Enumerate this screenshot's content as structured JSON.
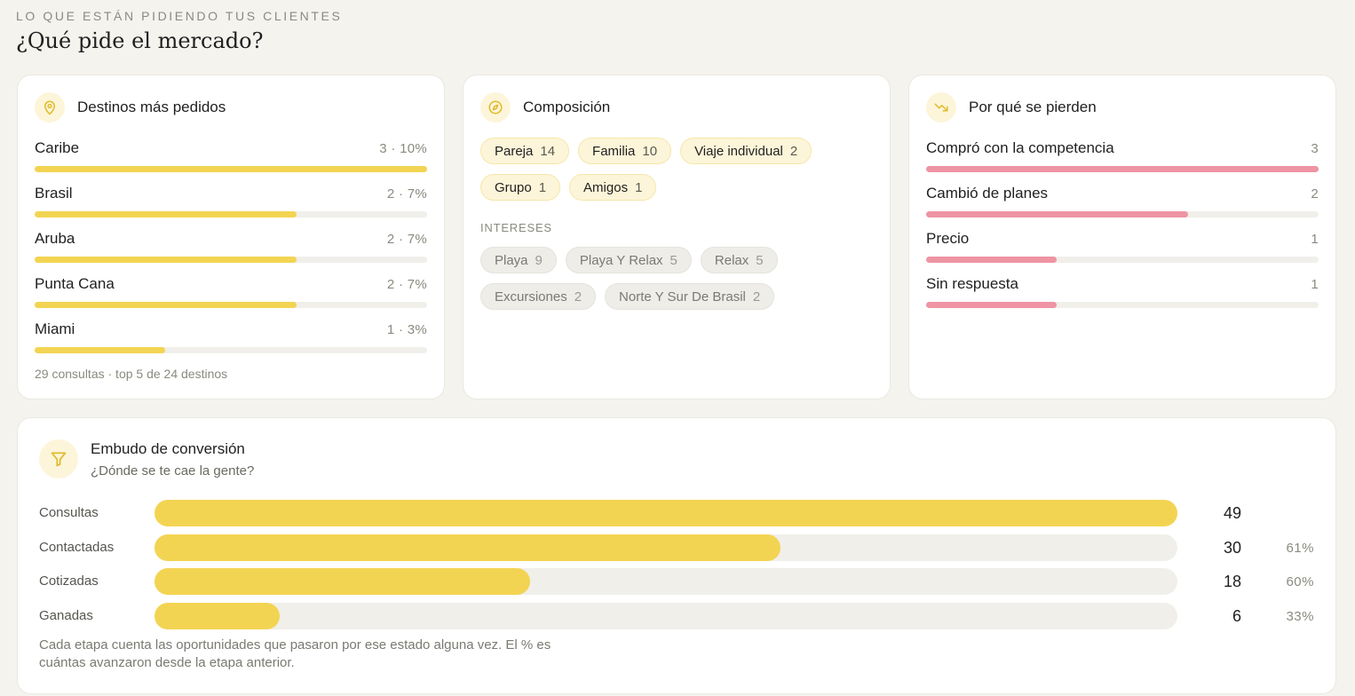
{
  "header": {
    "eyebrow": "LO QUE ESTÁN PIDIENDO TUS CLIENTES",
    "title": "¿Qué pide el mercado?"
  },
  "colors": {
    "accent": "#f3d452",
    "loss": "#ee94a3",
    "chip_bg": "#fdf5d9"
  },
  "destinos": {
    "title": "Destinos más pedidos",
    "icon": "map-pin-icon",
    "items": [
      {
        "label": "Caribe",
        "value": "3 · 10%",
        "fraction": 1.0
      },
      {
        "label": "Brasil",
        "value": "2 · 7%",
        "fraction": 0.667
      },
      {
        "label": "Aruba",
        "value": "2 · 7%",
        "fraction": 0.667
      },
      {
        "label": "Punta Cana",
        "value": "2 · 7%",
        "fraction": 0.667
      },
      {
        "label": "Miami",
        "value": "1 · 3%",
        "fraction": 0.333
      }
    ],
    "footer": "29 consultas · top 5 de 24 destinos"
  },
  "composicion": {
    "title": "Composición",
    "icon": "compass-icon",
    "chips": [
      {
        "label": "Pareja",
        "count": "14"
      },
      {
        "label": "Familia",
        "count": "10"
      },
      {
        "label": "Viaje individual",
        "count": "2"
      },
      {
        "label": "Grupo",
        "count": "1"
      },
      {
        "label": "Amigos",
        "count": "1"
      }
    ],
    "intereses_label": "INTERESES",
    "intereses": [
      {
        "label": "Playa",
        "count": "9"
      },
      {
        "label": "Playa Y Relax",
        "count": "5"
      },
      {
        "label": "Relax",
        "count": "5"
      },
      {
        "label": "Excursiones",
        "count": "2"
      },
      {
        "label": "Norte Y Sur De Brasil",
        "count": "2"
      }
    ]
  },
  "perdidas": {
    "title": "Por qué se pierden",
    "icon": "trending-down-icon",
    "items": [
      {
        "label": "Compró con la competencia",
        "value": "3",
        "fraction": 1.0
      },
      {
        "label": "Cambió de planes",
        "value": "2",
        "fraction": 0.667
      },
      {
        "label": "Precio",
        "value": "1",
        "fraction": 0.333
      },
      {
        "label": "Sin respuesta",
        "value": "1",
        "fraction": 0.333
      }
    ]
  },
  "embudo": {
    "title": "Embudo de conversión",
    "subtitle": "¿Dónde se te cae la gente?",
    "icon": "filter-icon",
    "stages": [
      {
        "label": "Consultas",
        "count": "49",
        "pct": "",
        "fraction": 1.0
      },
      {
        "label": "Contactadas",
        "count": "30",
        "pct": "61%",
        "fraction": 0.612
      },
      {
        "label": "Cotizadas",
        "count": "18",
        "pct": "60%",
        "fraction": 0.367
      },
      {
        "label": "Ganadas",
        "count": "6",
        "pct": "33%",
        "fraction": 0.122
      }
    ],
    "note": "Cada etapa cuenta las oportunidades que pasaron por ese estado alguna vez. El % es cuántas avanzaron desde la etapa anterior."
  }
}
